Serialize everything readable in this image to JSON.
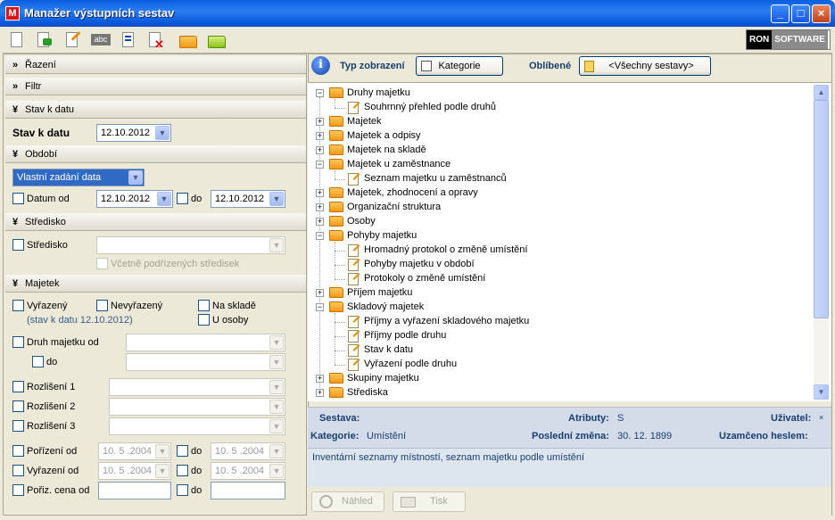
{
  "window": {
    "title": "Manažer výstupních sestav",
    "icon": "app-logo-icon",
    "min": "_",
    "max": "□",
    "close": "×"
  },
  "toolbar": {
    "items": [
      "new-document-icon",
      "export-icon",
      "edit-icon",
      "rename-icon",
      "properties-icon",
      "delete-icon",
      "open-folder-icon",
      "save-folder-icon"
    ],
    "logo_left": "RON",
    "logo_right": "SOFTWARE"
  },
  "left": {
    "razeni": "Řazení",
    "filtr": "Filtr",
    "stav_k_datu": {
      "header": "Stav k datu",
      "label": "Stav k datu",
      "value": "12.10.2012"
    },
    "obdobi": {
      "header": "Období",
      "mode": "Vlastní zadání data",
      "datum_od_label": "Datum od",
      "datum_od": "12.10.2012",
      "do_label": "do",
      "datum_do": "12.10.2012"
    },
    "stredisko": {
      "header": "Středisko",
      "label": "Středisko",
      "sub_label": "Včetně podřízených středisek"
    },
    "majetek": {
      "header": "Majetek",
      "vyrazeny": "Vyřazený",
      "nevyrazeny": "Nevyřazený",
      "na_sklade": "Na skladě",
      "u_osoby": "U osoby",
      "stav_note": "(stav k datu 12.10.2012)",
      "druh_od": "Druh majetku od",
      "druh_do": "do",
      "rozliseni1": "Rozlišení 1",
      "rozliseni2": "Rozlišení 2",
      "rozliseni3": "Rozlišení 3",
      "porizeni_od": "Pořízení od",
      "porizeni_od_value": "10. 5 .2004",
      "porizeni_do_label": "do",
      "porizeni_do_value": "10. 5 .2004",
      "vyrazeni_od": "Vyřazení od",
      "vyrazeni_od_value": "10. 5 .2004",
      "vyrazeni_do_label": "do",
      "vyrazeni_do_value": "10. 5 .2004",
      "poriz_cena_od": "Pořiz. cena od",
      "poriz_cena_do_label": "do"
    }
  },
  "right": {
    "typ_label": "Typ zobrazení",
    "typ_value": "Kategorie",
    "oblibene_label": "Oblíbené",
    "oblibene_value": "<Všechny sestavy>",
    "tree": [
      {
        "label": "Druhy majetku",
        "level": 0,
        "type": "folder",
        "open": true
      },
      {
        "label": "Souhrnný přehled podle druhů",
        "level": 1,
        "type": "report"
      },
      {
        "label": "Majetek",
        "level": 0,
        "type": "folder",
        "open": false
      },
      {
        "label": "Majetek a odpisy",
        "level": 0,
        "type": "folder",
        "open": false
      },
      {
        "label": "Majetek na skladě",
        "level": 0,
        "type": "folder",
        "open": false
      },
      {
        "label": "Majetek u zaměstnance",
        "level": 0,
        "type": "folder",
        "open": true
      },
      {
        "label": "Seznam majetku u zaměstnanců",
        "level": 1,
        "type": "report"
      },
      {
        "label": "Majetek, zhodnocení a opravy",
        "level": 0,
        "type": "folder",
        "open": false
      },
      {
        "label": "Organizační struktura",
        "level": 0,
        "type": "folder",
        "open": false
      },
      {
        "label": "Osoby",
        "level": 0,
        "type": "folder",
        "open": false
      },
      {
        "label": "Pohyby majetku",
        "level": 0,
        "type": "folder",
        "open": true
      },
      {
        "label": "Hromadný protokol o změně umístění",
        "level": 1,
        "type": "report"
      },
      {
        "label": "Pohyby majetku v období",
        "level": 1,
        "type": "report"
      },
      {
        "label": "Protokoly o změně umístění",
        "level": 1,
        "type": "report"
      },
      {
        "label": "Příjem majetku",
        "level": 0,
        "type": "folder",
        "open": false
      },
      {
        "label": "Skladový majetek",
        "level": 0,
        "type": "folder",
        "open": true
      },
      {
        "label": "Příjmy a vyřazení skladového majetku",
        "level": 1,
        "type": "report"
      },
      {
        "label": "Příjmy podle druhu",
        "level": 1,
        "type": "report"
      },
      {
        "label": "Stav k datu",
        "level": 1,
        "type": "report"
      },
      {
        "label": "Vyřazení podle druhu",
        "level": 1,
        "type": "report"
      },
      {
        "label": "Skupiny majetku",
        "level": 0,
        "type": "folder",
        "open": false
      },
      {
        "label": "Střediska",
        "level": 0,
        "type": "folder",
        "open": false
      }
    ],
    "info": {
      "sestava_label": "Sestava:",
      "sestava_value": "",
      "atributy_label": "Atributy:",
      "atributy_value": "S",
      "uzivatel_label": "Uživatel:",
      "uzivatel_value": "×",
      "kategorie_label": "Kategorie:",
      "kategorie_value": "Umístění",
      "zmena_label": "Poslední změna:",
      "zmena_value": "30. 12. 1899",
      "heslo_label": "Uzamčeno heslem:"
    },
    "description": "Inventární seznamy místností, seznam majetku podle umístění",
    "nahled": "Náhled",
    "tisk": "Tisk"
  }
}
